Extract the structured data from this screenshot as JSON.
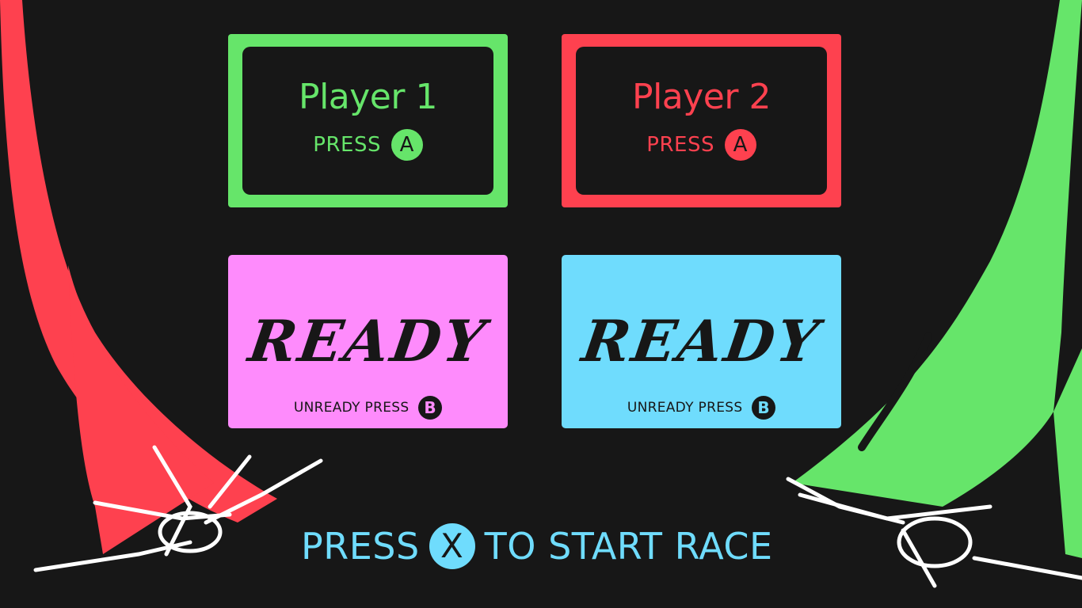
{
  "colors": {
    "background": "#171717",
    "player1": "#66e56a",
    "player2": "#fe414f",
    "player1_ready": "#fe8bfc",
    "player2_ready": "#6fdcfd",
    "start_prompt": "#6fdcfd"
  },
  "player_slots": [
    {
      "name": "Player 1",
      "press_label": "PRESS",
      "button": "A",
      "color": "#66e56a"
    },
    {
      "name": "Player 2",
      "press_label": "PRESS",
      "button": "A",
      "color": "#fe414f"
    }
  ],
  "ready_slots": [
    {
      "status": "READY",
      "unready_label": "UNREADY PRESS",
      "button": "B",
      "color": "#fe8bfc"
    },
    {
      "status": "READY",
      "unready_label": "UNREADY PRESS",
      "button": "B",
      "color": "#6fdcfd"
    }
  ],
  "start_prompt": {
    "before": "PRESS",
    "button": "X",
    "after": "TO START RACE"
  },
  "decorations": {
    "left_ship_trail": "red-ship-trail-icon",
    "right_ship_trail": "green-ship-trail-icon"
  }
}
